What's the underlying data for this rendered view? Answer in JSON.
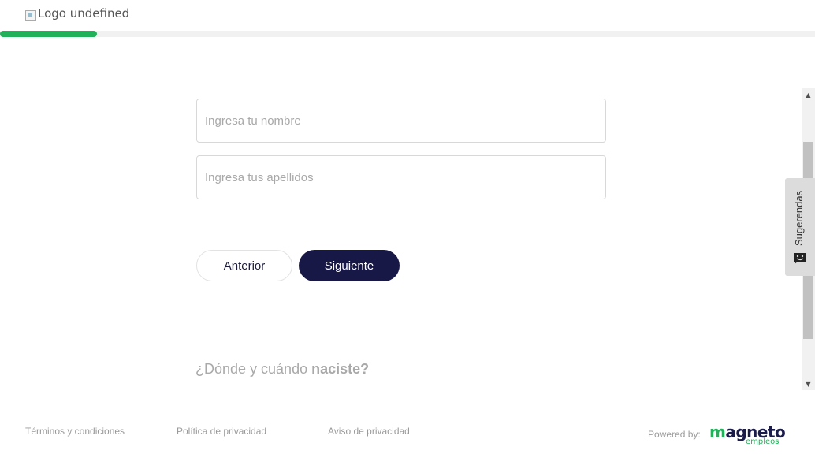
{
  "header": {
    "logo_alt": "Logo undefined",
    "progress_fraction": 0.119
  },
  "form": {
    "first_name": {
      "placeholder": "Ingresa tu nombre",
      "value": ""
    },
    "last_name": {
      "placeholder": "Ingresa tus apellidos",
      "value": ""
    },
    "prev_label": "Anterior",
    "next_label": "Siguiente"
  },
  "next_question": {
    "prefix": "¿Dónde y cuándo ",
    "emphasis": "naciste?"
  },
  "feedback": {
    "label": "Sugerendas",
    "icon": "chat-smile-icon"
  },
  "footer": {
    "terms": "Términos y condiciones",
    "privacy_policy": "Política de privacidad",
    "privacy_notice": "Aviso de privacidad",
    "powered_by": "Powered by:",
    "brand_main_a": "m",
    "brand_main_b": "agneto",
    "brand_sub": "empleos"
  },
  "colors": {
    "accent_green": "#21b15a",
    "primary_navy": "#181846"
  }
}
